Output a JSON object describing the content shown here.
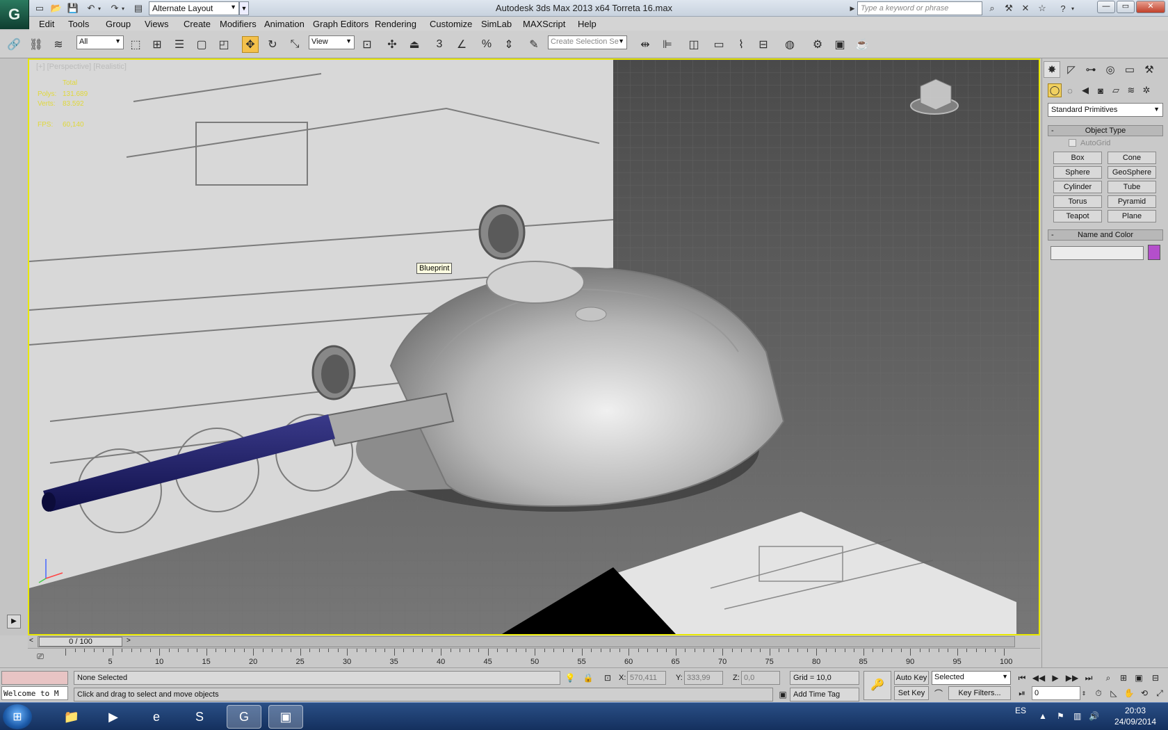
{
  "app": {
    "title": "Autodesk 3ds Max  2013 x64     Torreta 16.max",
    "workspace": "Alternate Layout",
    "search_placeholder": "Type a keyword or phrase"
  },
  "menu": [
    "Edit",
    "Tools",
    "Group",
    "Views",
    "Create",
    "Modifiers",
    "Animation",
    "Graph Editors",
    "Rendering",
    "Customize",
    "SimLab",
    "MAXScript",
    "Help"
  ],
  "toolbar": {
    "selection_filter": "All",
    "ref_coord": "View",
    "selection_set_placeholder": "Create Selection Se",
    "snap_label": "3"
  },
  "viewport": {
    "label": "[+] [Perspective] [Realistic]",
    "stats_header": "Total",
    "polys_label": "Polys:",
    "polys_value": "131.689",
    "verts_label": "Verts:",
    "verts_value": "83.592",
    "fps_label": "FPS:",
    "fps_value": "60,140",
    "tooltip": "Blueprint"
  },
  "command_panel": {
    "category": "Standard Primitives",
    "object_type_title": "Object Type",
    "autogrid_label": "AutoGrid",
    "primitives": [
      "Box",
      "Cone",
      "Sphere",
      "GeoSphere",
      "Cylinder",
      "Tube",
      "Torus",
      "Pyramid",
      "Teapot",
      "Plane"
    ],
    "name_color_title": "Name and Color",
    "object_color": "#b44fcb"
  },
  "timeline": {
    "slider_label": "0 / 100",
    "ticks": [
      "5",
      "10",
      "15",
      "20",
      "25",
      "30",
      "35",
      "40",
      "45",
      "50",
      "55",
      "60",
      "65",
      "70",
      "75",
      "80",
      "85",
      "90",
      "95",
      "100"
    ]
  },
  "status": {
    "listener_text": "Welcome to M",
    "selection": "None Selected",
    "prompt": "Click and drag to select and move objects",
    "x_label": "X:",
    "x_value": "570,411",
    "y_label": "Y:",
    "y_value": "333,99",
    "z_label": "Z:",
    "z_value": "0,0",
    "grid": "Grid = 10,0",
    "add_time_tag": "Add Time Tag",
    "auto_key": "Auto Key",
    "set_key": "Set Key",
    "key_mode": "Selected",
    "key_filters": "Key Filters...",
    "frame": "0"
  },
  "taskbar": {
    "language": "ES",
    "time": "20:03",
    "date": "24/09/2014"
  }
}
